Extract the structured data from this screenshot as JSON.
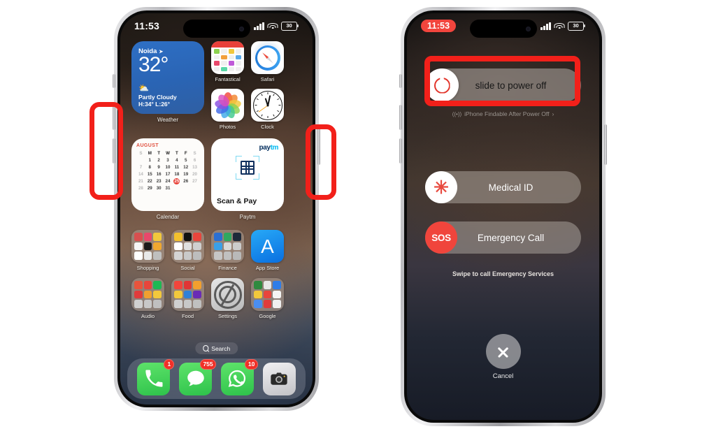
{
  "left_phone": {
    "label": "iphone-home-screen",
    "status_bar": {
      "time": "11:53",
      "signal": "cellular-signal-icon",
      "wifi": "wifi-icon",
      "battery_level": "30"
    },
    "weather_widget": {
      "city": "Noida",
      "location_arrow": "➤",
      "temperature": "32°",
      "icon": "partly-cloudy-icon",
      "condition": "Partly Cloudy",
      "high_low": "H:34° L:26°",
      "label": "Weather"
    },
    "calendar_widget": {
      "month": "AUGUST",
      "dow": [
        "S",
        "M",
        "T",
        "W",
        "T",
        "F",
        "S"
      ],
      "leading_blanks": 1,
      "days": [
        1,
        2,
        3,
        4,
        5,
        6,
        7,
        8,
        9,
        10,
        11,
        12,
        13,
        14,
        15,
        16,
        17,
        18,
        19,
        20,
        21,
        22,
        23,
        24,
        25,
        26,
        27,
        28,
        29,
        30,
        31
      ],
      "today": 25,
      "label": "Calendar"
    },
    "paytm_widget": {
      "brand_a": "pay",
      "brand_b": "tm",
      "icon": "qr-scan-icon",
      "action": "Scan & Pay",
      "label": "Paytm"
    },
    "apps_row1": [
      {
        "name": "Fantastical",
        "icon": "fantastical-icon"
      },
      {
        "name": "Safari",
        "icon": "safari-compass-icon"
      }
    ],
    "apps_row2": [
      {
        "name": "Photos",
        "icon": "photos-pinwheel-icon"
      },
      {
        "name": "Clock",
        "icon": "clock-face-icon"
      }
    ],
    "folders_row1": [
      {
        "name": "Shopping",
        "icon": "folder-icon",
        "colors": [
          "#d84f4f",
          "#e8486b",
          "#f2c83c",
          "#f5f5f5",
          "#1b1b1b",
          "#f0a830",
          "#ffffff",
          "#e8e8e8",
          "#bfbfbf"
        ]
      },
      {
        "name": "Social",
        "icon": "folder-icon",
        "colors": [
          "#f2c02e",
          "#111111",
          "#e8453c",
          "#ffffff",
          "#e0e0e0",
          "#cfcfcf",
          "#d4d4d4",
          "#c9c9c9",
          "#bdbdbd"
        ]
      },
      {
        "name": "Finance",
        "icon": "folder-icon",
        "colors": [
          "#2b6fd1",
          "#2fa860",
          "#1e2a3a",
          "#3aa0e8",
          "#d8d8d8",
          "#cccccc",
          "#c6c6c6",
          "#c0c0c0",
          "#b9b9b9"
        ]
      },
      {
        "name": "App Store",
        "icon": "appstore-icon",
        "glyph": "A"
      }
    ],
    "folders_row2": [
      {
        "name": "Audio",
        "icon": "folder-icon",
        "colors": [
          "#e8543c",
          "#e8453c",
          "#1db954",
          "#e03b3b",
          "#f0a030",
          "#f2c83c",
          "#d0d0d0",
          "#c8c8c8",
          "#c0c0c0"
        ]
      },
      {
        "name": "Food",
        "icon": "folder-icon",
        "colors": [
          "#f2453c",
          "#e03535",
          "#f2a02e",
          "#f2c83c",
          "#2f80d8",
          "#6a2bb5",
          "#d0d0d0",
          "#c8c8c8",
          "#c0c0c0"
        ]
      },
      {
        "name": "Settings",
        "icon": "settings-gear-icon"
      },
      {
        "name": "Google",
        "icon": "folder-icon",
        "colors": [
          "#2f8a3f",
          "#e8e8e8",
          "#2f7de8",
          "#f2c83c",
          "#e8453c",
          "#f5f5f5",
          "#4a8ef0",
          "#e03b3b",
          "#f0f0f0"
        ]
      }
    ],
    "search_pill": {
      "icon": "search-icon",
      "label": "Search"
    },
    "dock": [
      {
        "name": "Phone",
        "icon": "phone-icon",
        "badge": "1"
      },
      {
        "name": "Messages",
        "icon": "messages-icon",
        "badge": "755"
      },
      {
        "name": "WhatsApp",
        "icon": "whatsapp-icon",
        "badge": "10"
      },
      {
        "name": "Camera",
        "icon": "camera-icon",
        "badge": ""
      }
    ],
    "side_buttons": {
      "mute": "mute-switch",
      "volume_up": "volume-up-button",
      "volume_down": "volume-down-button"
    }
  },
  "right_phone": {
    "label": "iphone-power-off-screen",
    "status_bar": {
      "time": "11:53",
      "time_is_recording": true,
      "signal": "cellular-signal-icon",
      "wifi": "wifi-icon",
      "battery_level": "30"
    },
    "power_slider": {
      "icon": "power-icon",
      "label": "slide to power off"
    },
    "findable": {
      "icon": "findmy-icon",
      "label": "iPhone Findable After Power Off",
      "chevron": "›"
    },
    "medical_id": {
      "icon": "medical-star-icon",
      "label": "Medical ID"
    },
    "emergency_call": {
      "icon": "sos-icon",
      "icon_text": "SOS",
      "label": "Emergency Call"
    },
    "swipe_note": "Swipe to call Emergency Services",
    "cancel": {
      "icon": "close-x-icon",
      "label": "Cancel"
    },
    "side_buttons": {
      "power": "side-power-button"
    }
  },
  "annotations": [
    {
      "name": "annotation-volume-buttons",
      "target": "volume buttons",
      "color": "#f2201a"
    },
    {
      "name": "annotation-side-button",
      "target": "side power button",
      "color": "#f2201a"
    },
    {
      "name": "annotation-power-slider",
      "target": "slide to power off",
      "color": "#f2201a"
    }
  ],
  "colors": {
    "annotation_red": "#f2201a",
    "badge_red": "#f03028",
    "power_red": "#e2342a",
    "sos_red": "#f0453c",
    "weather_blue": "#2e6fc4",
    "calendar_today_red": "#e8453c",
    "background": "#ffffff"
  }
}
